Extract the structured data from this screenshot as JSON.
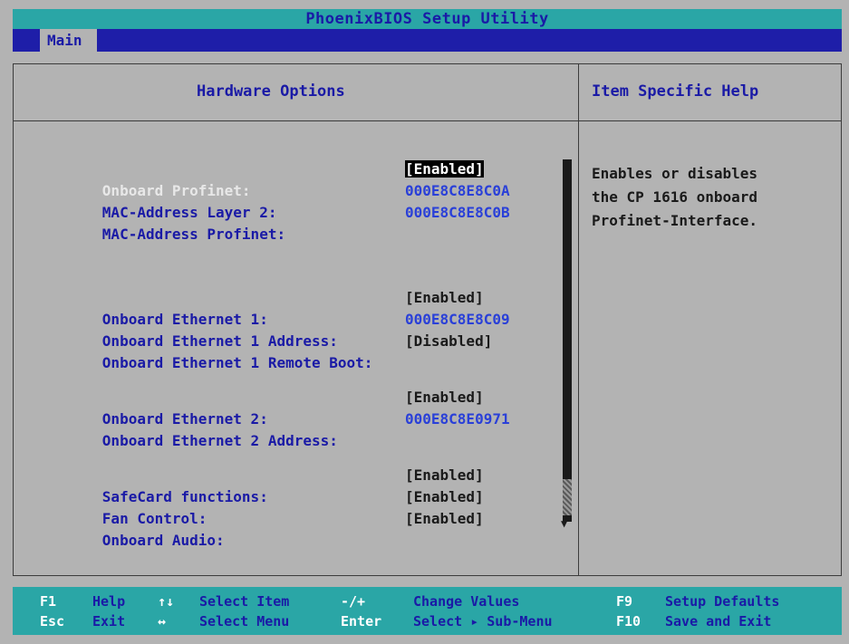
{
  "title": "PhoenixBIOS Setup Utility",
  "menu": {
    "active_tab": "Main"
  },
  "panel": {
    "left_header": "Hardware Options",
    "right_header": "Item Specific Help"
  },
  "settings": [
    {
      "label": "Onboard Profinet:",
      "value": "[Enabled]",
      "selected": true
    },
    {
      "label": "MAC-Address Layer 2:",
      "value": "000E8C8E8C0A"
    },
    {
      "label": "MAC-Address Profinet:",
      "value": "000E8C8E8C0B"
    },
    {
      "label": "Onboard Ethernet 1:",
      "value": "[Enabled]"
    },
    {
      "label": "Onboard Ethernet 1 Address:",
      "value": "000E8C8E8C09"
    },
    {
      "label": "Onboard Ethernet 1 Remote Boot:",
      "value": "[Disabled]"
    },
    {
      "label": "Onboard Ethernet 2:",
      "value": "[Enabled]"
    },
    {
      "label": "Onboard Ethernet 2 Address:",
      "value": "000E8C8E0971"
    },
    {
      "label": "SafeCard functions:",
      "value": "[Enabled]"
    },
    {
      "label": "Fan Control:",
      "value": "[Enabled]"
    },
    {
      "label": "Onboard Audio:",
      "value": "[Enabled]"
    }
  ],
  "help_text": "Enables or disables\nthe CP 1616 onboard\nProfinet-Interface.",
  "footer": {
    "f1_key": "F1",
    "f1_desc": "Help",
    "updown_key": "↑↓",
    "updown_desc": "Select Item",
    "plusminus_key": "-/+",
    "plusminus_desc": "Change Values",
    "f9_key": "F9",
    "f9_desc": "Setup Defaults",
    "esc_key": "Esc",
    "esc_desc": "Exit",
    "leftright_key": "↔",
    "leftright_desc": "Select Menu",
    "enter_key": "Enter",
    "enter_desc": "Select ▸ Sub-Menu",
    "f10_key": "F10",
    "f10_desc": "Save and Exit"
  },
  "colors": {
    "bios_gray": "#b3b3b3",
    "title_teal": "#2aa6a6",
    "menu_blue": "#1e1ea8",
    "text_blue": "#1a1aa6",
    "mac_blue": "#2a40d8"
  }
}
